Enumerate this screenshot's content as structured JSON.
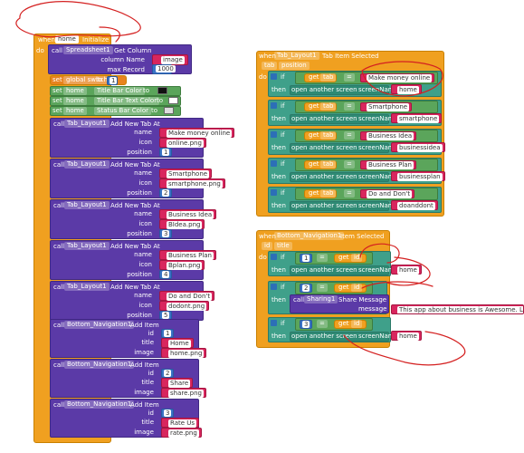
{
  "left": {
    "when": "when",
    "do": "do",
    "component": "home",
    "event": "Initialize",
    "call": "call",
    "spreadsheet": "Spreadsheet1",
    "get_column": "Get Column",
    "column_name_label": "column Name",
    "column_name_value": "image",
    "max_record_label": "max Record",
    "max_record_value": "1000",
    "set": "set",
    "global_switch": "global switch",
    "to": "to",
    "switch_value": "1",
    "title_bar_color": "Title Bar Color",
    "title_bar_text_color": "Title Bar Text Color",
    "status_bar_color": "Status Bar Color",
    "colors": {
      "title_bar": "#111111",
      "title_bar_text": "#ffffff",
      "status_bar": "#dddddd"
    },
    "tab_layout": "Tab_Layout1",
    "add_new_tab": "Add New Tab At",
    "name_label": "name",
    "icon_label": "icon",
    "position_label": "position",
    "tabs": [
      {
        "name": "Make money online",
        "icon": "online.png",
        "position": "1"
      },
      {
        "name": "Smartphone",
        "icon": "smartphone.png",
        "position": "2"
      },
      {
        "name": "Business Idea",
        "icon": "BIdea.png",
        "position": "3"
      },
      {
        "name": "Business Plan",
        "icon": "Bplan.png",
        "position": "4"
      },
      {
        "name": "Do and Don't",
        "icon": "dodont.png",
        "position": "5"
      }
    ],
    "bottom_nav": "Bottom_Navigation1",
    "add_item": "Add Item",
    "id_label": "id",
    "title_label": "title",
    "image_label": "image",
    "items": [
      {
        "id": "1",
        "title": "Home",
        "image": "home.png"
      },
      {
        "id": "2",
        "title": "Share",
        "image": "share.png"
      },
      {
        "id": "3",
        "title": "Rate Us",
        "image": "rate.png"
      }
    ]
  },
  "right_top": {
    "when": "when",
    "component": "Tab_Layout1",
    "event": "Tab Item Selected",
    "param_tab": "tab",
    "param_position": "position",
    "do": "do",
    "if": "if",
    "then": "then",
    "get": "get",
    "get_var": "tab",
    "eq": "=",
    "open_screen": "open another screen",
    "screen_name_label": "screenName",
    "rows": [
      {
        "compare": "Make money online",
        "screen": "home"
      },
      {
        "compare": "Smartphone",
        "screen": "smartphone"
      },
      {
        "compare": "Business Idea",
        "screen": "businessidea"
      },
      {
        "compare": "Business Plan",
        "screen": "businessplan"
      },
      {
        "compare": "Do and Don't",
        "screen": "doanddont"
      }
    ]
  },
  "right_bottom": {
    "when": "when",
    "component": "Bottom_Navigation1",
    "event": "Item Selected",
    "param_id": "id",
    "param_title": "title",
    "do": "do",
    "if": "if",
    "then": "then",
    "get": "get",
    "get_var": "id",
    "eq": "=",
    "open_screen": "open another screen",
    "screen_name_label": "screenName",
    "call": "call",
    "sharing": "Sharing1",
    "share_message": "Share Message",
    "message_label": "message",
    "message_value": "This app about business is Awesome. Let's have",
    "rows": [
      {
        "num": "1",
        "screen": "home"
      },
      {
        "num": "2"
      },
      {
        "num": "3",
        "screen": "home"
      }
    ]
  }
}
